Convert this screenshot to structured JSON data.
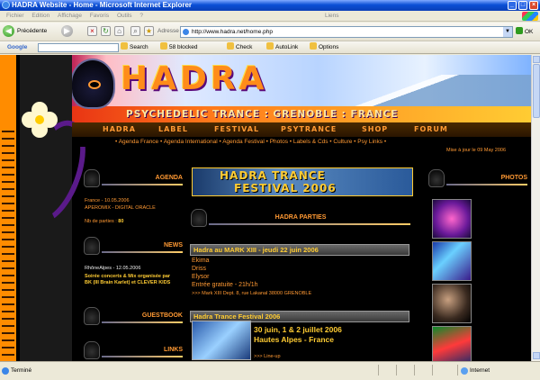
{
  "window": {
    "title": "HADRA Website - Home - Microsoft Internet Explorer",
    "menu": [
      "Fichier",
      "Edition",
      "Affichage",
      "Favoris",
      "Outils",
      "?"
    ],
    "links_label": "Liens"
  },
  "toolbar": {
    "back_label": "Précédente",
    "address_label": "Adresse",
    "url": "http://www.hadra.net/home.php",
    "go_label": "OK"
  },
  "google": {
    "logo": "Google",
    "search_label": "Search",
    "blocked_label": "58 blocked",
    "check_label": "Check",
    "autolink_label": "AutoLink",
    "options_label": "Options"
  },
  "site": {
    "logo": "HADRA",
    "tagline": "PSYCHEDELIC TRANCE : GRENOBLE : FRANCE",
    "nav": [
      "HADRA",
      "LABEL",
      "FESTIVAL",
      "PSYTRANCE",
      "SHOP",
      "FORUM"
    ],
    "sublinks": "• Agenda France • Agenda International • Agenda Festival • Photos • Labels & Cds • Culture • Psy Links •",
    "updated": "Mise à jour le 09 May 2006"
  },
  "left": {
    "agenda": {
      "title": "AGENDA",
      "date": "France - 10.05.2006",
      "event": "APEROMIX - DIGITAL ORACLE",
      "parties_label": "Nb de parties : ",
      "parties_count": "80"
    },
    "news": {
      "title": "NEWS",
      "date": "RhôneAlpes - 12.05.2006",
      "text1": "Soirée concerts & Mix organisée par",
      "text2": "BK (III Brain Karlet) et CLEVER KIDS"
    },
    "guestbook": {
      "title": "GUESTBOOK"
    },
    "links": {
      "title": "LINKS"
    }
  },
  "center": {
    "festival_banner_l1": "HADRA TRANCE",
    "festival_banner_l2": "FESTIVAL 2006",
    "parties_title": "HADRA PARTIES",
    "party1": {
      "title": "Hadra au MARK XIII - jeudi 22 juin 2006",
      "artists": [
        "Ekima",
        "Driss",
        "Elysor"
      ],
      "entry": "Entrée gratuite - 21h/1h",
      "address": ">>> Mark XIII Dept. 8, rue Lakanal 38000 GRENOBLE"
    },
    "party2": {
      "title": "Hadra Trance Festival 2006",
      "dates": "30 juin, 1 & 2 juillet 2006",
      "place": "Hautes Alpes - France",
      "lineup": ">>> Line-up"
    }
  },
  "right": {
    "photos_title": "PHOTOS"
  },
  "status": {
    "left": "Terminé",
    "zone": "Internet"
  }
}
